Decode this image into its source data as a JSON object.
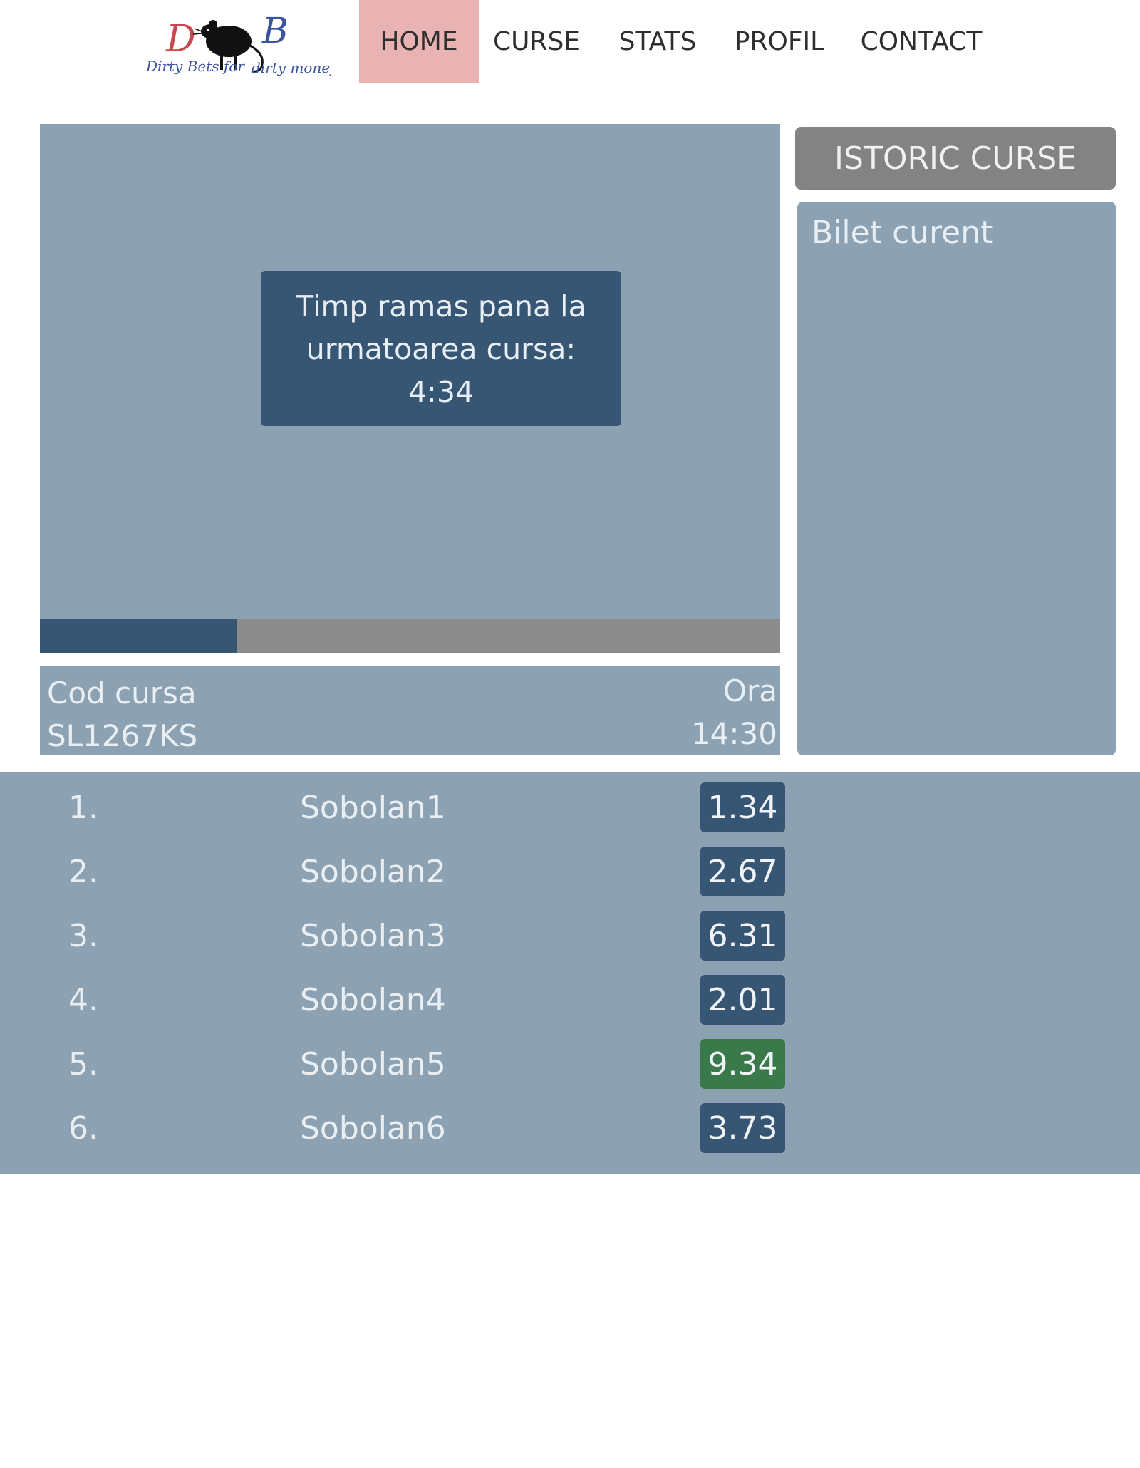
{
  "logo": {
    "line1": "Dirty Bets for",
    "line2": "dirty money",
    "letters": [
      "D",
      "B"
    ]
  },
  "nav": [
    {
      "label": "HOME",
      "active": true
    },
    {
      "label": "CURSE",
      "active": false
    },
    {
      "label": "STATS",
      "active": false
    },
    {
      "label": "PROFIL",
      "active": false
    },
    {
      "label": "CONTACT",
      "active": false
    }
  ],
  "race": {
    "timer_line1": "Timp ramas pana la",
    "timer_line2": "urmatoarea cursa:",
    "timer_value": "4:34",
    "progress_fraction": 0.266,
    "code_label": "Cod cursa",
    "code_value": "SL1267KS",
    "time_label": "Ora",
    "time_value": "14:30"
  },
  "sidebar": {
    "history_button": "ISTORIC CURSE",
    "ticket_title": "Bilet curent"
  },
  "odds": [
    {
      "rank": "1.",
      "name": "Sobolan1",
      "value": "1.34",
      "highlight": false
    },
    {
      "rank": "2.",
      "name": "Sobolan2",
      "value": "2.67",
      "highlight": false
    },
    {
      "rank": "3.",
      "name": "Sobolan3",
      "value": "6.31",
      "highlight": false
    },
    {
      "rank": "4.",
      "name": "Sobolan4",
      "value": "2.01",
      "highlight": false
    },
    {
      "rank": "5.",
      "name": "Sobolan5",
      "value": "9.34",
      "highlight": true
    },
    {
      "rank": "6.",
      "name": "Sobolan6",
      "value": "3.73",
      "highlight": false
    }
  ],
  "colors": {
    "primary_dark": "#375673",
    "panel": "#8ca2b3",
    "nav_active": "#e9b3b3",
    "button_grey": "#838383",
    "highlight_green": "#3a7a4a"
  }
}
